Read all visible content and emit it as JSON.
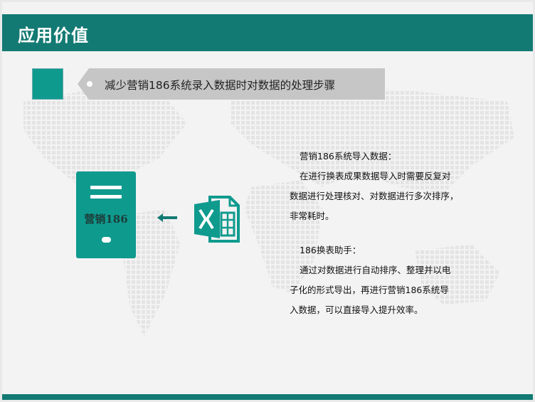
{
  "header": {
    "title": "应用价值"
  },
  "banner": {
    "text": "减少营销186系统录入数据时对数据的处理步骤"
  },
  "device": {
    "label": "营销186"
  },
  "section1": {
    "heading": "营销186系统导入数据：",
    "body_line1": "在进行换表成果数据导入时需要反复对",
    "body_line2": "数据进行处理核对、对数据进行多次排序，",
    "body_line3": "非常耗时。"
  },
  "section2": {
    "heading": "186换表助手：",
    "body_line1": "通过对数据进行自动排序、整理并以电",
    "body_line2": "子化的形式导出，再进行营销186系统导",
    "body_line3": "入数据，可以直接导入提升效率。"
  },
  "colors": {
    "primary": "#127a73",
    "accent": "#0f9a8e",
    "banner_gray": "#c6c6c6"
  },
  "icons": [
    "server-icon",
    "arrow-left-icon",
    "excel-file-icon",
    "world-map-background"
  ]
}
